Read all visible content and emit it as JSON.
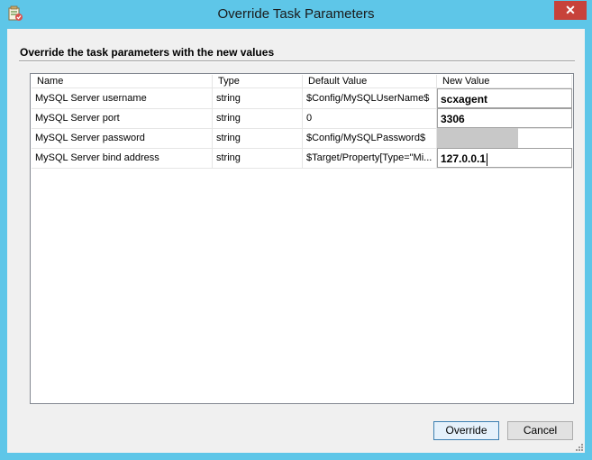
{
  "window": {
    "title": "Override Task Parameters",
    "close_glyph": "✕",
    "app_icon": "task-icon"
  },
  "heading": {
    "text": "Override the task parameters with the new values"
  },
  "grid": {
    "columns": [
      "Name",
      "Type",
      "Default Value",
      "New Value"
    ],
    "rows": [
      {
        "name": "MySQL Server username",
        "type": "string",
        "default": "$Config/MySQLUserName$",
        "new_value": "scxagent"
      },
      {
        "name": "MySQL Server port",
        "type": "string",
        "default": "0",
        "new_value": "3306"
      },
      {
        "name": "MySQL Server password",
        "type": "string",
        "default": "$Config/MySQLPassword$",
        "new_value": ""
      },
      {
        "name": "MySQL Server bind address",
        "type": "string",
        "default": "$Target/Property[Type=\"Mi...",
        "new_value": "127.0.0.1"
      }
    ]
  },
  "buttons": {
    "override": "Override",
    "cancel": "Cancel"
  },
  "colors": {
    "title_bar": "#5ec6e8",
    "close_button": "#c7423a"
  }
}
